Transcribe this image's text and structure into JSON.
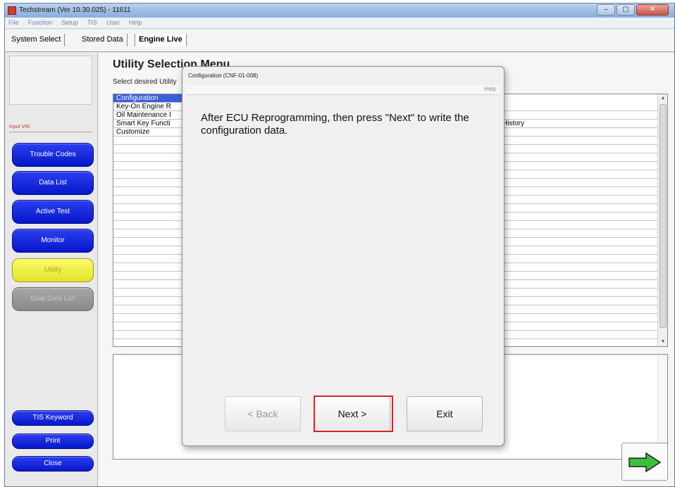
{
  "window": {
    "title": "Techstream (Ver 10.30.025) - 11611",
    "controls": {
      "minimize": "–",
      "maximize": "▢",
      "close": "✕"
    }
  },
  "menu": [
    "File",
    "Function",
    "Setup",
    "TIS",
    "User",
    "Help"
  ],
  "tabs": [
    "System Select",
    "Stored Data",
    "Engine Live"
  ],
  "sidebar": {
    "input_vin": "Input VIN",
    "buttons": [
      "Trouble Codes",
      "Data List",
      "Active Test",
      "Monitor",
      "Utility",
      "Dual Data List"
    ],
    "bottom_buttons": [
      "TIS Keyword",
      "Print",
      "Close"
    ]
  },
  "main": {
    "title": "Utility Selection Menu",
    "subtitle": "Select desired Utility",
    "list_items": [
      "Configuration",
      "Key-On Engine R",
      "Oil Maintenance I",
      "Smart Key Functi",
      "Customize"
    ],
    "list_extra": "History"
  },
  "dialog": {
    "title": "Configuration (CNF-01-008)",
    "help": "Help",
    "message": "After ECU Reprogramming, then press \"Next\" to write the configuration data.",
    "back_label": "< Back",
    "next_label": "Next >",
    "exit_label": "Exit"
  },
  "icons": {
    "next_arrow": "arrow-right-icon"
  },
  "colors": {
    "nav_blue": "#0617c9",
    "utility_yellow": "#fbfb6a",
    "highlight_red": "#e02020"
  }
}
